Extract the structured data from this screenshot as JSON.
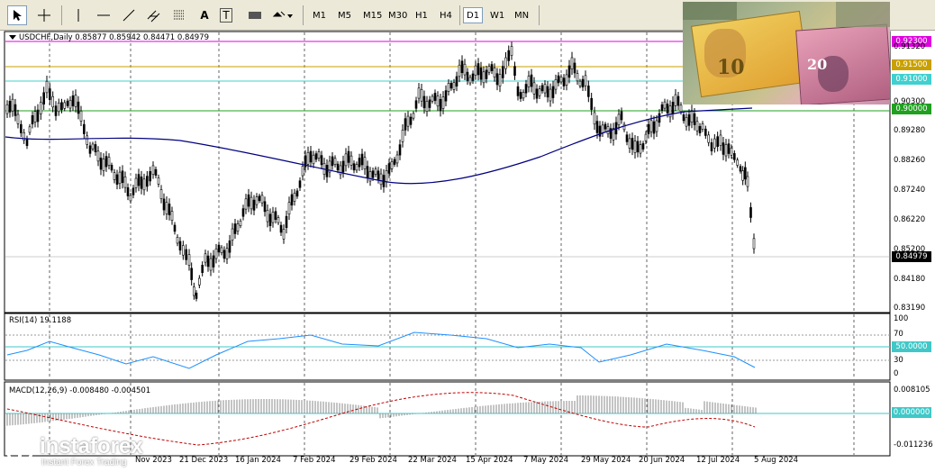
{
  "toolbar": {
    "timeframes": [
      "M1",
      "M5",
      "M15",
      "M30",
      "H1",
      "H4",
      "D1",
      "W1",
      "MN"
    ],
    "active_timeframe": "D1",
    "text_tool_label": "A",
    "text_label_tool_label": "T"
  },
  "chart": {
    "symbol_line": "USDCHF,Daily  0.85877 0.85942 0.84471 0.84979",
    "current_price": "0.84979",
    "levels": [
      {
        "price": "0.92300",
        "color": "#e000e0"
      },
      {
        "price": "0.91500",
        "color": "#c8a000"
      },
      {
        "price": "0.91000",
        "color": "#40d0d0"
      },
      {
        "price": "0.90000",
        "color": "#20a020"
      }
    ],
    "price_axis": [
      "0.90300",
      "0.89280",
      "0.88260",
      "0.87240",
      "0.86220",
      "0.85200",
      "0.84180",
      "0.83190"
    ],
    "price_axis_partial": "0.91320"
  },
  "rsi": {
    "label": "RSI(14) 19.1188",
    "axis": [
      "100",
      "70",
      "30",
      "0"
    ],
    "level_tag": "50.0000"
  },
  "macd": {
    "label": "MACD(12,26,9) -0.008480 -0.004501",
    "axis_top": "0.008105",
    "axis_bottom": "-0.011236",
    "zero_tag": "0.000000"
  },
  "dates": [
    "Nov 2023",
    "21 Dec 2023",
    "16 Jan 2024",
    "7 Feb 2024",
    "29 Feb 2024",
    "22 Mar 2024",
    "15 Apr 2024",
    "7 May 2024",
    "29 May 2024",
    "20 Jun 2024",
    "12 Jul 2024",
    "5 Aug 2024"
  ],
  "watermark": {
    "brand": "instaforex",
    "tagline": "Instant Forex Trading"
  },
  "colors": {
    "ma": "#000080",
    "rsi": "#1e90ff",
    "macd_signal": "#c00000",
    "level_tag": "#20a020"
  }
}
